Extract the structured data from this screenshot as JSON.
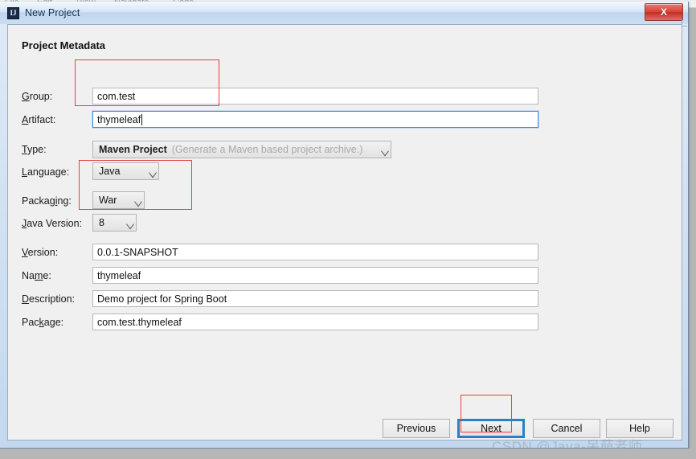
{
  "window": {
    "title": "New Project",
    "app_icon": "intellij-idea-icon",
    "close_label": "X",
    "close_icon": "close-icon"
  },
  "background": {
    "menu_items": [
      "File",
      "Edit",
      "View",
      "Navigate",
      "Code"
    ]
  },
  "dialog": {
    "heading": "Project Metadata",
    "fields": [
      {
        "key": "group",
        "label": "Group:",
        "mnemonic": "G",
        "value": "com.test"
      },
      {
        "key": "artifact",
        "label": "Artifact:",
        "mnemonic": "A",
        "value": "thymeleaf"
      },
      {
        "key": "type",
        "label": "Type:",
        "mnemonic": "T",
        "value": "Maven Project",
        "hint": "(Generate a Maven based project archive.)"
      },
      {
        "key": "language",
        "label": "Language:",
        "mnemonic": "L",
        "value": "Java"
      },
      {
        "key": "packaging",
        "label": "Packaging:",
        "mnemonic": "i",
        "value": "War"
      },
      {
        "key": "java_version",
        "label": "Java Version:",
        "mnemonic": "J",
        "value": "8"
      },
      {
        "key": "version",
        "label": "Version:",
        "mnemonic": "V",
        "value": "0.0.1-SNAPSHOT"
      },
      {
        "key": "name",
        "label": "Name:",
        "mnemonic": "m",
        "value": "thymeleaf"
      },
      {
        "key": "description",
        "label": "Description:",
        "mnemonic": "D",
        "value": "Demo project for Spring Boot"
      },
      {
        "key": "package",
        "label": "Package:",
        "mnemonic": "k",
        "value": "com.test.thymeleaf"
      }
    ],
    "labels": {
      "group": "Group:",
      "artifact": "Artifact:",
      "type": "Type:",
      "language": "Language:",
      "packaging": "Packaging:",
      "java_version": "Java Version:",
      "version": "Version:",
      "name": "Name:",
      "description": "Description:",
      "package": "Package:"
    },
    "values": {
      "group": "com.test",
      "artifact": "thymeleaf",
      "type": "Maven Project",
      "type_hint": "(Generate a Maven based project archive.)",
      "language": "Java",
      "packaging": "War",
      "java_version": "8",
      "version": "0.0.1-SNAPSHOT",
      "name": "thymeleaf",
      "description": "Demo project for Spring Boot",
      "package": "com.test.thymeleaf"
    },
    "buttons": {
      "previous": "Previous",
      "next": "Next",
      "cancel": "Cancel",
      "help": "Help"
    }
  },
  "annotations": {
    "accent_color": "#e8413a",
    "focus_color": "#2c7fc0",
    "boxes": [
      "group-artifact-highlight",
      "packaging-javaversion-highlight",
      "next-button-highlight"
    ]
  },
  "watermark": {
    "text": "CSDN @Java-呆萌老师"
  }
}
